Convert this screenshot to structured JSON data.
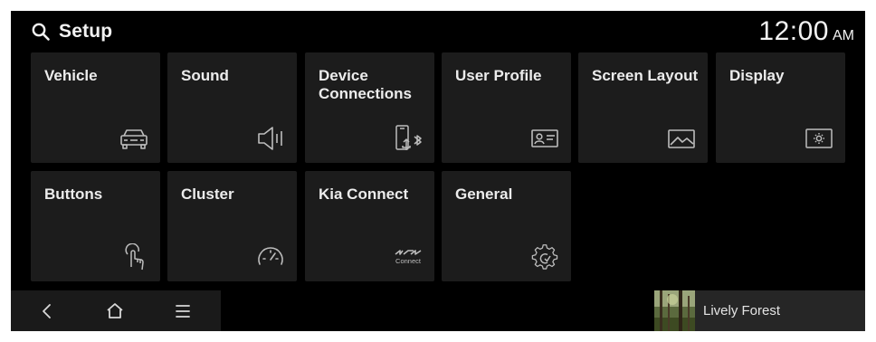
{
  "header": {
    "title": "Setup",
    "search_icon": "search-icon"
  },
  "clock": {
    "time": "12:00",
    "ampm": "AM"
  },
  "tiles": [
    {
      "label": "Vehicle",
      "icon": "car-icon"
    },
    {
      "label": "Sound",
      "icon": "speaker-icon"
    },
    {
      "label": "Device Connections",
      "icon": "phone-bluetooth-usb-icon"
    },
    {
      "label": "User Profile",
      "icon": "profile-card-icon"
    },
    {
      "label": "Screen Layout",
      "icon": "picture-icon"
    },
    {
      "label": "Display",
      "icon": "display-brightness-icon"
    },
    {
      "label": "Buttons",
      "icon": "touch-button-icon"
    },
    {
      "label": "Cluster",
      "icon": "speedometer-icon"
    },
    {
      "label": "Kia Connect",
      "icon": "kia-connect-icon",
      "icon_text": "Connect"
    },
    {
      "label": "General",
      "icon": "settings-gear-icon"
    }
  ],
  "nav": {
    "back_icon": "back-icon",
    "home_icon": "home-icon",
    "menu_icon": "menu-icon"
  },
  "media": {
    "track": "Lively Forest",
    "art_icon": "album-art"
  },
  "colors": {
    "background": "#000000",
    "tile": "#1c1c1c",
    "text": "#ececec",
    "bar": "#1a1a1a"
  }
}
